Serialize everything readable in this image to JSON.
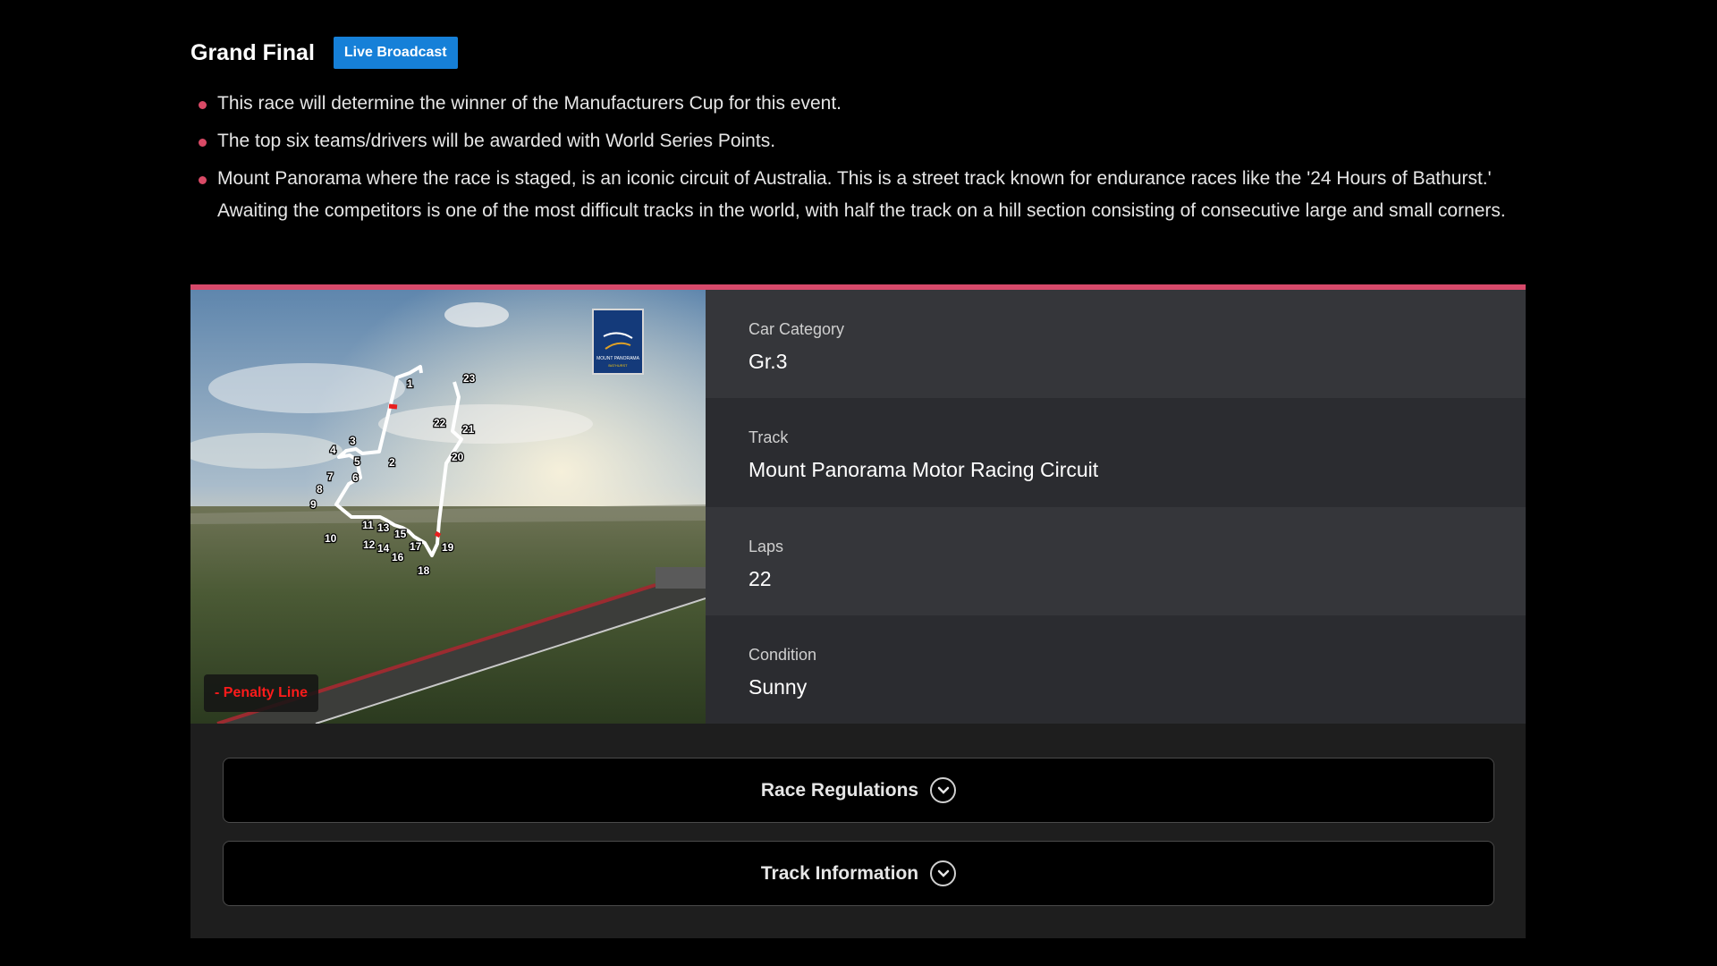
{
  "header": {
    "title": "Grand Final",
    "badge": "Live Broadcast"
  },
  "bullets": [
    "This race will determine the winner of the Manufacturers Cup for this event.",
    "The top six teams/drivers will be awarded with World Series Points.",
    "Mount Panorama where the race is staged, is an iconic circuit of Australia. This is a street track known for endurance races like the '24 Hours of Bathurst.' Awaiting the competitors is one of the most difficult tracks in the world, with half the track on a hill section consisting of consecutive large and small corners."
  ],
  "track_image": {
    "penalty_legend": "- Penalty Line",
    "logo_text": "MOUNT PANORAMA",
    "logo_sub": "BATHURST",
    "corners": [
      "1",
      "2",
      "3",
      "4",
      "5",
      "6",
      "7",
      "8",
      "9",
      "10",
      "11",
      "12",
      "13",
      "14",
      "15",
      "16",
      "17",
      "18",
      "19",
      "20",
      "21",
      "22",
      "23"
    ]
  },
  "specs": [
    {
      "label": "Car Category",
      "value": "Gr.3"
    },
    {
      "label": "Track",
      "value": "Mount Panorama Motor Racing Circuit"
    },
    {
      "label": "Laps",
      "value": "22"
    },
    {
      "label": "Condition",
      "value": "Sunny"
    }
  ],
  "accordions": [
    {
      "label": "Race Regulations"
    },
    {
      "label": "Track Information"
    }
  ],
  "colors": {
    "accent": "#d6496a",
    "badge": "#1680d8",
    "penalty": "#ff1b1b"
  }
}
